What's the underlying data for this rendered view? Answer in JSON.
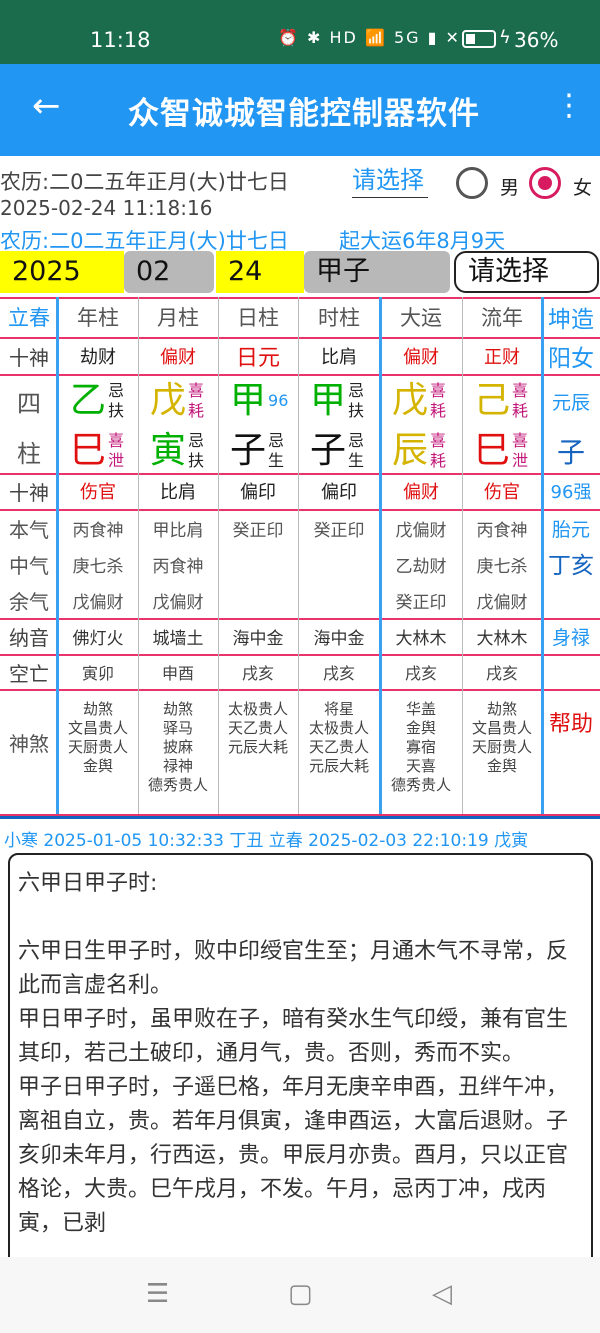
{
  "status": {
    "time": "11:18",
    "icons": "⏰ ✱ HD 📶 5G ▮ ✕",
    "battery": "36%",
    "battery_level": 0.36
  },
  "appbar": {
    "title": "众智诚城智能控制器软件",
    "back_icon": "←",
    "more_icon": "⋮"
  },
  "info": {
    "lunar_date": "农历:二0二五年正月(大)廿七日",
    "datetime": "2025-02-24 11:18:16",
    "select_label": "请选择",
    "lunar_date2": "农历:二0二五年正月(大)廿七日",
    "qiyun": "起大运6年8月9天",
    "gender_male": "男",
    "gender_female": "女"
  },
  "inputs": {
    "year": "2025",
    "month": "02",
    "day": "24",
    "hour": "甲子",
    "select": "请选择"
  },
  "colors": {
    "wood": "#00b000",
    "earth": "#d4b400",
    "fire": "#e01010",
    "water": "#111111",
    "accent": "#2196f3",
    "magenta": "#c2187a"
  },
  "chart": {
    "header": {
      "label": "立春",
      "cols": [
        "年柱",
        "月柱",
        "日柱",
        "时柱",
        "大运",
        "流年"
      ],
      "side": "坤造"
    },
    "shishen_top": {
      "label": "十神",
      "vals": [
        "劫财",
        "偏财",
        "日元",
        "比肩",
        "偏财",
        "正财"
      ],
      "side": "阳女"
    },
    "sizhu_label": {
      "a": "四",
      "b": "柱"
    },
    "tiangan": [
      {
        "char": "乙",
        "s1": "忌",
        "s2": "扶"
      },
      {
        "char": "戊",
        "s1": "喜",
        "s2": "耗"
      },
      {
        "char": "甲",
        "s1": "96",
        "s2": ""
      },
      {
        "char": "甲",
        "s1": "忌",
        "s2": "扶"
      },
      {
        "char": "戊",
        "s1": "喜",
        "s2": "耗"
      },
      {
        "char": "己",
        "s1": "喜",
        "s2": "耗"
      }
    ],
    "dizhi": [
      {
        "char": "巳",
        "s1": "喜",
        "s2": "泄"
      },
      {
        "char": "寅",
        "s1": "忌",
        "s2": "扶"
      },
      {
        "char": "子",
        "s1": "忌",
        "s2": "生"
      },
      {
        "char": "子",
        "s1": "忌",
        "s2": "生"
      },
      {
        "char": "辰",
        "s1": "喜",
        "s2": "耗"
      },
      {
        "char": "巳",
        "s1": "喜",
        "s2": "泄"
      }
    ],
    "side_yuanchen": "元辰",
    "side_zi": "子",
    "shishen_bottom": {
      "label": "十神",
      "vals": [
        "伤官",
        "比肩",
        "偏印",
        "偏印",
        "偏财",
        "伤官"
      ],
      "side": "96强"
    },
    "canggan_labels": [
      "本气",
      "中气",
      "余气"
    ],
    "canggan": [
      [
        "丙食神",
        "庚七杀",
        "戊偏财"
      ],
      [
        "甲比肩",
        "丙食神",
        "戊偏财"
      ],
      [
        "癸正印",
        "",
        ""
      ],
      [
        "癸正印",
        "",
        ""
      ],
      [
        "戊偏财",
        "乙劫财",
        "癸正印"
      ],
      [
        "丙食神",
        "庚七杀",
        "戊偏财"
      ]
    ],
    "side_taiyuan": "胎元",
    "side_dinghai": "丁亥",
    "nayin": {
      "label": "纳音",
      "vals": [
        "佛灯火",
        "城墙土",
        "海中金",
        "海中金",
        "大林木",
        "大林木"
      ],
      "side": "身禄"
    },
    "kongwang": {
      "label": "空亡",
      "vals": [
        "寅卯",
        "申酉",
        "戌亥",
        "戌亥",
        "戌亥",
        "戌亥"
      ]
    },
    "shensha": {
      "label": "神煞",
      "vals": [
        [
          "劫煞",
          "文昌贵人",
          "天厨贵人",
          "金舆"
        ],
        [
          "劫煞",
          "驿马",
          "披麻",
          "禄神",
          "德秀贵人"
        ],
        [
          "太极贵人",
          "天乙贵人",
          "元辰大耗"
        ],
        [
          "将星",
          "太极贵人",
          "天乙贵人",
          "元辰大耗"
        ],
        [
          "华盖",
          "金舆",
          "寡宿",
          "天喜",
          "德秀贵人"
        ],
        [
          "劫煞",
          "文昌贵人",
          "天厨贵人",
          "金舆"
        ]
      ],
      "side": "帮助"
    }
  },
  "jieqi": "小寒  2025-01-05 10:32:33 丁丑    立春  2025-02-03 22:10:19 戊寅",
  "text": {
    "title": "六甲日甲子时:",
    "body": "六甲日生甲子时，败中印绶官生至；月通木气不寻常，反此而言虚名利。\n甲日甲子时，虽甲败在子，暗有癸水生气印绶，兼有官生其印，若己土破印，通月气，贵。否则，秀而不实。\n甲子日甲子时，子遥巳格，年月无庚辛申酉，丑绊午冲，离祖自立，贵。若年月俱寅，逢申酉运，大富后退财。子亥卯未年月，行西运，贵。甲辰月亦贵。酉月，只以正官格论，大贵。巳午戌月，不发。午月，忌丙丁冲，戌丙寅，已剥"
  },
  "navbar": {
    "menu_icon": "☰",
    "home_icon": "▢",
    "back_icon": "◁"
  }
}
